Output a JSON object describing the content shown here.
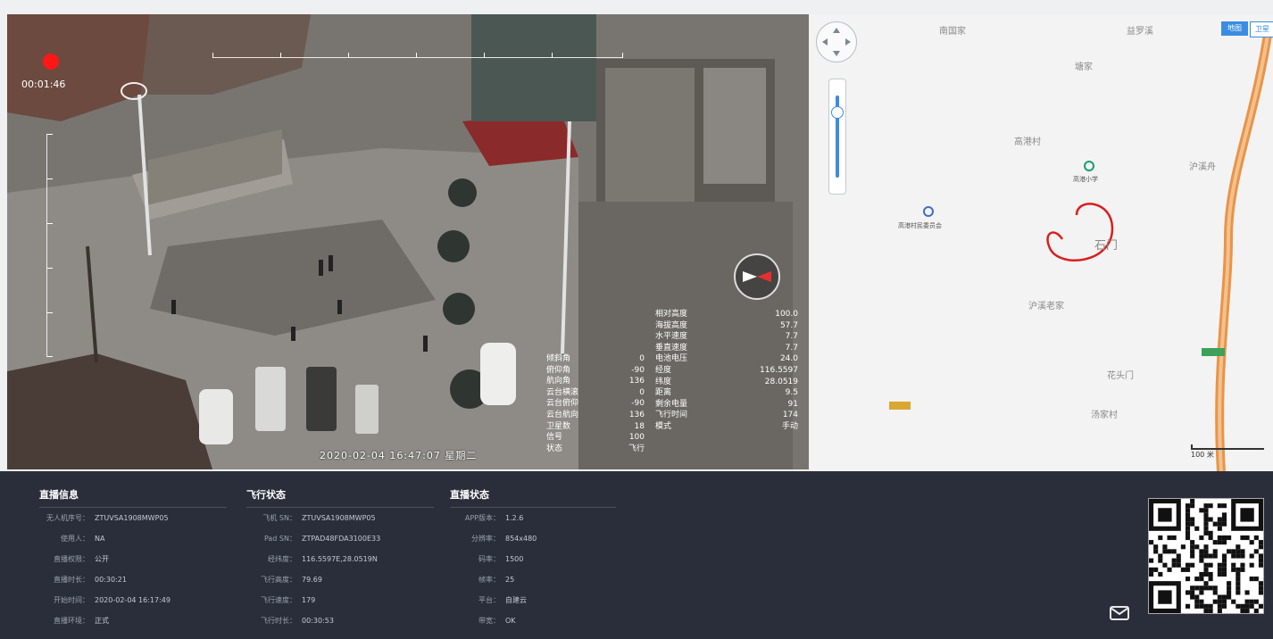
{
  "video": {
    "timer": "00:01:46",
    "caption": "2020-02-04 16:47:07 星期二",
    "telemetry_left": [
      {
        "label": "倾斜角",
        "value": "0"
      },
      {
        "label": "俯仰角",
        "value": "-90"
      },
      {
        "label": "航向角",
        "value": "136"
      },
      {
        "label": "云台横滚",
        "value": "0"
      },
      {
        "label": "云台俯仰",
        "value": "-90"
      },
      {
        "label": "云台航向",
        "value": "136"
      },
      {
        "label": "卫星数",
        "value": "18"
      },
      {
        "label": "信号",
        "value": "100"
      },
      {
        "label": "状态",
        "value": "飞行"
      }
    ],
    "telemetry_right": [
      {
        "label": "相对高度",
        "value": "100.0"
      },
      {
        "label": "海拔高度",
        "value": "57.7"
      },
      {
        "label": "水平速度",
        "value": "7.7"
      },
      {
        "label": "垂直速度",
        "value": "7.7"
      },
      {
        "label": "电池电压",
        "value": "24.0"
      },
      {
        "label": "经度",
        "value": "116.5597"
      },
      {
        "label": "纬度",
        "value": "28.0519"
      },
      {
        "label": "距离",
        "value": "9.5"
      },
      {
        "label": "剩余电量",
        "value": "91"
      },
      {
        "label": "飞行时间",
        "value": "174"
      },
      {
        "label": "模式",
        "value": "手动"
      }
    ]
  },
  "map": {
    "places": [
      {
        "name": "南国家"
      },
      {
        "name": "益罗溪"
      },
      {
        "name": "塘家"
      },
      {
        "name": "高港村"
      },
      {
        "name": "沪溪舟"
      },
      {
        "name": "石门"
      },
      {
        "name": "沪溪老家"
      },
      {
        "name": "花头门"
      },
      {
        "name": "汤家村"
      }
    ],
    "pois": [
      "高港小学",
      "高港村民委员会"
    ],
    "buttons": [
      "地图",
      "卫星"
    ],
    "scale_label": "100 米",
    "route_color": "#e8944b",
    "track_color": "#d8201e"
  },
  "info": {
    "live": {
      "title": "直播信息",
      "items": [
        {
          "k": "无人机序号：",
          "v": "ZTUVSA1908MWP05"
        },
        {
          "k": "使用人：",
          "v": "NA"
        },
        {
          "k": "直播权限：",
          "v": "公开"
        },
        {
          "k": "直播时长：",
          "v": "00:30:21"
        },
        {
          "k": "开始时间：",
          "v": "2020-02-04 16:17:49"
        },
        {
          "k": "直播环境：",
          "v": "正式"
        }
      ]
    },
    "flight": {
      "title": "飞行状态",
      "items": [
        {
          "k": "飞机 SN：",
          "v": "ZTUVSA1908MWP05"
        },
        {
          "k": "Pad SN：",
          "v": "ZTPAD48FDA3100E33"
        },
        {
          "k": "经纬度：",
          "v": "116.5597E,28.0519N"
        },
        {
          "k": "飞行高度：",
          "v": "79.69"
        },
        {
          "k": "飞行速度：",
          "v": "179"
        },
        {
          "k": "飞行时长：",
          "v": "00:30:53"
        }
      ]
    },
    "stream": {
      "title": "直播状态",
      "items": [
        {
          "k": "APP版本：",
          "v": "1.2.6"
        },
        {
          "k": "分辨率：",
          "v": "854x480"
        },
        {
          "k": "码率：",
          "v": "1500"
        },
        {
          "k": "帧率：",
          "v": "25"
        },
        {
          "k": "平台：",
          "v": "自建云"
        },
        {
          "k": "带宽：",
          "v": "OK"
        }
      ]
    }
  },
  "colors": {
    "panel_bg": "#2a2e3a",
    "rec": "#ff1616"
  },
  "icons": [
    "record-dot-icon",
    "compass-icon",
    "map-pan-icon",
    "zoom-slider-icon",
    "mail-icon",
    "qr-code-icon"
  ]
}
